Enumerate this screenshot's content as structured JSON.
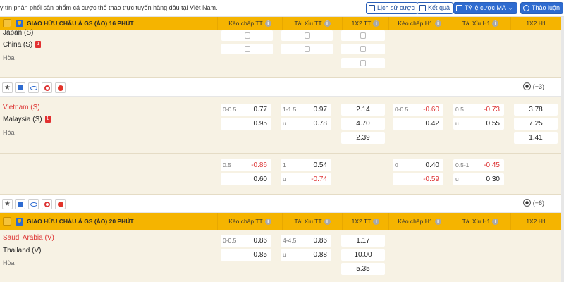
{
  "topbar": {
    "marquee": "y tín phân phối sản phẩm cá cược thể thao trực tuyến hàng đầu tại Việt Nam.",
    "history_label": "Lịch sử cược",
    "results_label": "Kết quả",
    "odds_type_label": "Tỷ lệ cược MA",
    "discuss_label": "Thảo luận"
  },
  "columns": {
    "hdp_ft": "Kèo chấp TT",
    "ou_ft": "Tài Xỉu TT",
    "x12_ft": "1X2 TT",
    "hdp_h1": "Kèo chấp H1",
    "ou_h1": "Tài Xỉu H1",
    "x12_h1": "1X2 H1"
  },
  "leagues": [
    {
      "name": "GIAO HỮU CHÂU Á GS (ẢO) 16 PHÚT"
    },
    {
      "name": "GIAO HỮU CHÂU Á GS (ẢO) 20 PHÚT"
    }
  ],
  "matches": [
    {
      "home": "Japan (S)",
      "away": "China (S)",
      "draw": "Hòa",
      "red_card": "1"
    },
    {
      "home": "Vietnam (S)",
      "away": "Malaysia (S)",
      "draw": "Hòa",
      "red_card": "1",
      "hdp_ft": {
        "line": "0-0.5",
        "home": "0.77",
        "away": "0.95"
      },
      "ou_ft": {
        "line": "1-1.5",
        "over": "0.97",
        "u": "u",
        "under": "0.78"
      },
      "x12_ft": [
        "2.14",
        "4.70",
        "2.39"
      ],
      "hdp_h1": {
        "line": "0-0.5",
        "home": "-0.60",
        "away": "0.42"
      },
      "ou_h1": {
        "line": "0.5",
        "over": "-0.73",
        "u": "u",
        "under": "0.55"
      },
      "x12_h1": [
        "3.78",
        "7.25",
        "1.41"
      ],
      "alt": {
        "hdp_ft": {
          "line": "0.5",
          "home": "-0.86",
          "away": "0.60"
        },
        "ou_ft": {
          "line": "1",
          "over": "0.54",
          "u": "u",
          "under": "-0.74"
        },
        "hdp_h1": {
          "line": "0",
          "home": "0.40",
          "away": "-0.59"
        },
        "ou_h1": {
          "line": "0.5-1",
          "over": "-0.45",
          "u": "u",
          "under": "0.30"
        }
      },
      "more": "(+3)"
    },
    {
      "more_prev": "(+6)",
      "home": "Saudi Arabia (V)",
      "away": "Thailand (V)",
      "draw": "Hòa",
      "hdp_ft": {
        "line": "0-0.5",
        "home": "0.86",
        "away": "0.85"
      },
      "ou_ft": {
        "line": "4-4.5",
        "over": "0.86",
        "u": "u",
        "under": "0.88"
      },
      "x12_ft": [
        "1.17",
        "10.00",
        "5.35"
      ]
    }
  ],
  "colors": {
    "league_bar": "#f5b400",
    "row_bg": "#f7f2e4",
    "negative": "#d33333",
    "accent": "#2e6bd0"
  },
  "icons": [
    "star-icon",
    "chart-icon",
    "eye-icon",
    "live-icon",
    "fire-icon",
    "soccer-ball-icon",
    "info-icon",
    "lock-icon",
    "trophy-icon"
  ]
}
